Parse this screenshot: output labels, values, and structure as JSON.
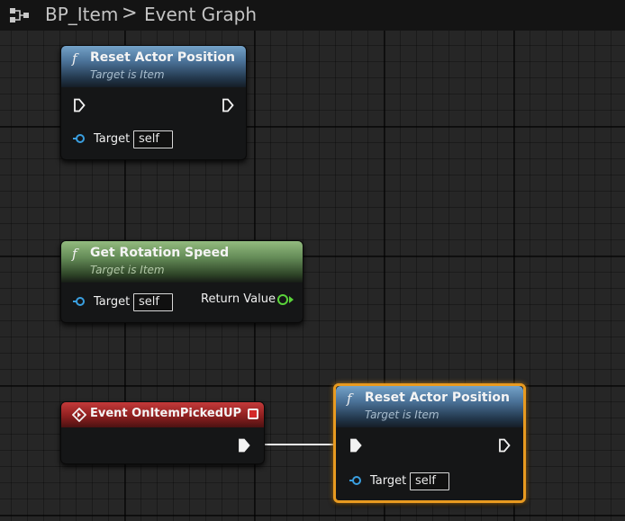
{
  "breadcrumb": {
    "blueprint": "BP_Item",
    "separator": ">",
    "graph": "Event Graph"
  },
  "nodes": [
    {
      "title": "Reset Actor Position",
      "subtitle": "Target is Item",
      "function_glyph": "f",
      "pins": {
        "target_label": "Target",
        "target_value": "self"
      },
      "color": "#4a7197"
    },
    {
      "title": "Get Rotation Speed",
      "subtitle": "Target is Item",
      "function_glyph": "f",
      "pins": {
        "target_label": "Target",
        "target_value": "self",
        "output_label": "Return Value"
      },
      "color": "#648b57"
    },
    {
      "title": "Event OnItemPickedUP",
      "color": "#8e1f1f"
    },
    {
      "title": "Reset Actor Position",
      "subtitle": "Target is Item",
      "function_glyph": "f",
      "pins": {
        "target_label": "Target",
        "target_value": "self"
      },
      "selected": true,
      "color": "#4a7197",
      "selection_color": "#e89a20"
    }
  ],
  "colors": {
    "exec_pin": "#ffffff",
    "object_pin": "#3a9fe0",
    "float_pin": "#5ad33a"
  }
}
